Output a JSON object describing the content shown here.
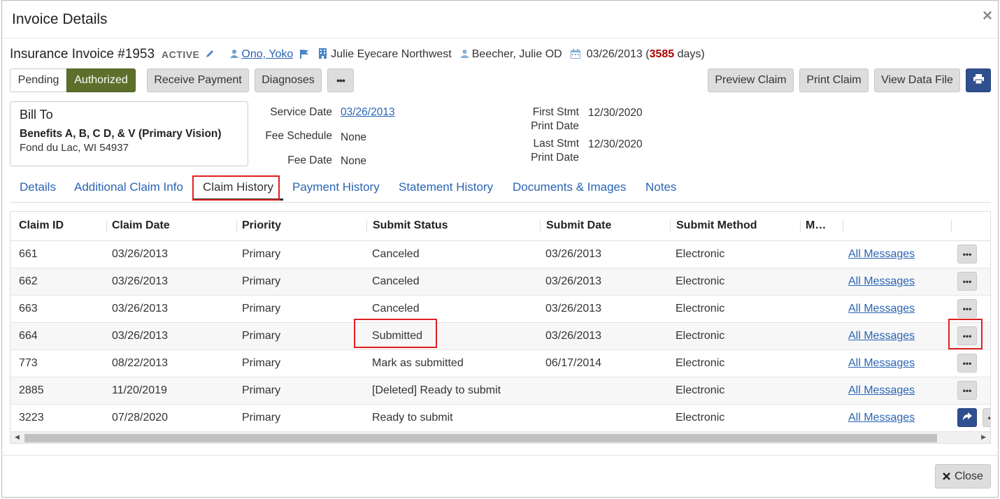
{
  "modal": {
    "title": "Invoice Details",
    "close_x": "×"
  },
  "invoice": {
    "title": "Insurance Invoice #1953",
    "status": "ACTIVE",
    "patient": "Ono, Yoko",
    "location": "Julie Eyecare Northwest",
    "provider": "Beecher, Julie OD",
    "date": "03/26/2013",
    "days_open": "(",
    "days_count": "3585",
    "days_close": " days)"
  },
  "toolbar": {
    "pending": "Pending",
    "authorized": "Authorized",
    "receive_payment": "Receive Payment",
    "diagnoses": "Diagnoses",
    "more": "•••",
    "preview_claim": "Preview Claim",
    "print_claim": "Print Claim",
    "view_data_file": "View Data File"
  },
  "bill_to": {
    "heading": "Bill To",
    "name": "Benefits A, B, C D, & V (Primary Vision)",
    "address": "Fond du Lac, WI 54937"
  },
  "fields": {
    "service_date_label": "Service Date",
    "service_date": "03/26/2013",
    "fee_schedule_label": "Fee Schedule",
    "fee_schedule": "None",
    "fee_date_label": "Fee Date",
    "fee_date": "None",
    "first_stmt_label_1": "First Stmt",
    "first_stmt_label_2": "Print Date",
    "first_stmt": "12/30/2020",
    "last_stmt_label_1": "Last Stmt",
    "last_stmt_label_2": "Print Date",
    "last_stmt": "12/30/2020"
  },
  "tabs": [
    "Details",
    "Additional Claim Info",
    "Claim History",
    "Payment History",
    "Statement History",
    "Documents & Images",
    "Notes"
  ],
  "grid": {
    "columns": [
      "Claim ID",
      "Claim Date",
      "Priority",
      "Submit Status",
      "Submit Date",
      "Submit Method",
      "M…"
    ],
    "rows": [
      {
        "id": "661",
        "date": "03/26/2013",
        "priority": "Primary",
        "status": "Canceled",
        "submit_date": "03/26/2013",
        "method": "Electronic",
        "messages": "All Messages"
      },
      {
        "id": "662",
        "date": "03/26/2013",
        "priority": "Primary",
        "status": "Canceled",
        "submit_date": "03/26/2013",
        "method": "Electronic",
        "messages": "All Messages"
      },
      {
        "id": "663",
        "date": "03/26/2013",
        "priority": "Primary",
        "status": "Canceled",
        "submit_date": "03/26/2013",
        "method": "Electronic",
        "messages": "All Messages"
      },
      {
        "id": "664",
        "date": "03/26/2013",
        "priority": "Primary",
        "status": "Submitted",
        "submit_date": "03/26/2013",
        "method": "Electronic",
        "messages": "All Messages"
      },
      {
        "id": "773",
        "date": "08/22/2013",
        "priority": "Primary",
        "status": "Mark as submitted",
        "submit_date": "06/17/2014",
        "method": "Electronic",
        "messages": "All Messages"
      },
      {
        "id": "2885",
        "date": "11/20/2019",
        "priority": "Primary",
        "status": "[Deleted] Ready to submit",
        "submit_date": "",
        "method": "Electronic",
        "messages": "All Messages"
      },
      {
        "id": "3223",
        "date": "07/28/2020",
        "priority": "Primary",
        "status": "Ready to submit",
        "submit_date": "",
        "method": "Electronic",
        "messages": "All Messages"
      }
    ]
  },
  "footer": {
    "close": "Close"
  },
  "colors": {
    "accent_link": "#2a64b3",
    "authorized": "#5c6f2b",
    "print_button": "#2f4f8f",
    "highlight": "#e02020",
    "days": "#aa0000"
  }
}
